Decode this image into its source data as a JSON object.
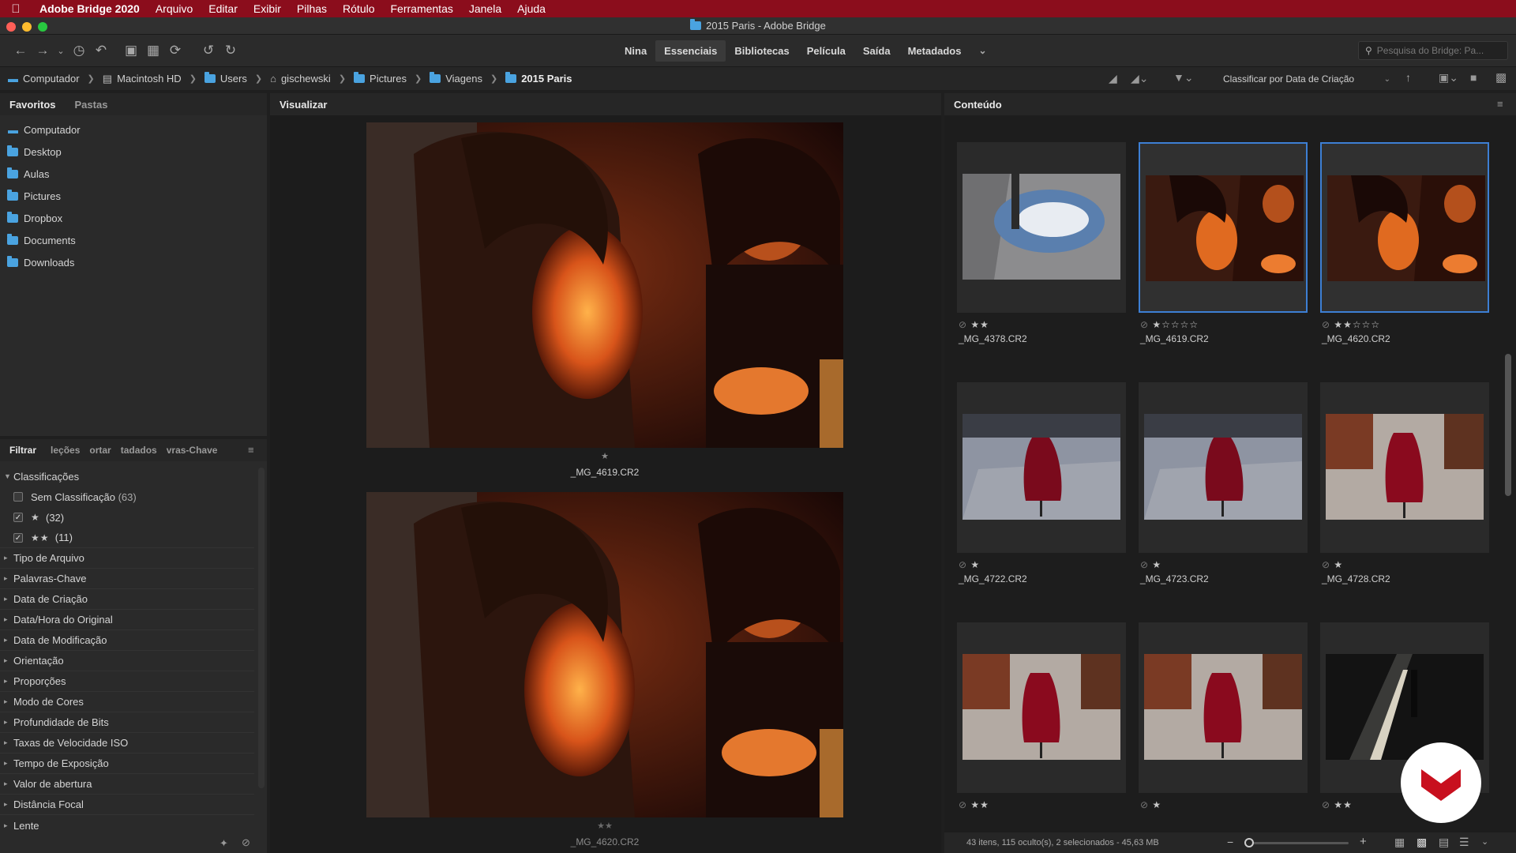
{
  "menubar": {
    "items": [
      "Adobe Bridge 2020",
      "Arquivo",
      "Editar",
      "Exibir",
      "Pilhas",
      "Rótulo",
      "Ferramentas",
      "Janela",
      "Ajuda"
    ]
  },
  "window": {
    "title": "2015 Paris - Adobe Bridge"
  },
  "workspaces": [
    "Nina",
    "Essenciais",
    "Bibliotecas",
    "Película",
    "Saída",
    "Metadados"
  ],
  "search": {
    "placeholder": "Pesquisa do Bridge: Pa..."
  },
  "breadcrumb": [
    "Computador",
    "Macintosh HD",
    "Users",
    "gischewski",
    "Pictures",
    "Viagens",
    "2015 Paris"
  ],
  "sort": {
    "label": "Classificar por Data de Criação"
  },
  "left_panel": {
    "tabs": [
      "Favoritos",
      "Pastas"
    ],
    "favorites": [
      "Computador",
      "Desktop",
      "Aulas",
      "Pictures",
      "Dropbox",
      "Documents",
      "Downloads"
    ]
  },
  "filter_panel": {
    "tabs": [
      "Filtrar",
      "leções",
      "ortar",
      "tadados",
      "vras-Chave"
    ],
    "section": "Classificações",
    "ratings": [
      {
        "label": "Sem Classificação",
        "count": "(63)",
        "stars": ""
      },
      {
        "label": "",
        "count": "(32)",
        "stars": "★"
      },
      {
        "label": "",
        "count": "(11)",
        "stars": "★★"
      }
    ],
    "categories": [
      "Tipo de Arquivo",
      "Palavras-Chave",
      "Data de Criação",
      "Data/Hora do Original",
      "Data de Modificação",
      "Orientação",
      "Proporções",
      "Modo de Cores",
      "Profundidade de Bits",
      "Taxas de Velocidade ISO",
      "Tempo de Exposição",
      "Valor de abertura",
      "Distância Focal",
      "Lente"
    ]
  },
  "preview_panel": {
    "tab": "Visualizar",
    "images": [
      {
        "name": "_MG_4619.CR2",
        "stars": "★"
      },
      {
        "name": "_MG_4620.CR2",
        "stars": "★★"
      }
    ]
  },
  "content_panel": {
    "tab": "Conteúdo",
    "thumbs": [
      {
        "name": "_MG_4378.CR2",
        "stars": "★★",
        "kind": "puddle",
        "selected": false
      },
      {
        "name": "_MG_4619.CR2",
        "stars": "★☆☆☆☆",
        "kind": "girls",
        "selected": true
      },
      {
        "name": "_MG_4620.CR2",
        "stars": "★★☆☆☆",
        "kind": "girls",
        "selected": true
      },
      {
        "name": "_MG_4722.CR2",
        "stars": "★",
        "kind": "coat",
        "selected": false
      },
      {
        "name": "_MG_4723.CR2",
        "stars": "★",
        "kind": "coat",
        "selected": false
      },
      {
        "name": "_MG_4728.CR2",
        "stars": "★",
        "kind": "coat2",
        "selected": false
      },
      {
        "name": "",
        "stars": "★★",
        "kind": "coat2",
        "selected": false
      },
      {
        "name": "",
        "stars": "★",
        "kind": "coat2",
        "selected": false
      },
      {
        "name": "",
        "stars": "★★",
        "kind": "dark",
        "selected": false
      }
    ],
    "status": "43 itens, 115 oculto(s), 2 selecionados - 45,63 MB"
  },
  "colors": {
    "accent": "#3d7fd4",
    "menubar": "#8b0d1c",
    "panel": "#2a2a2a"
  }
}
